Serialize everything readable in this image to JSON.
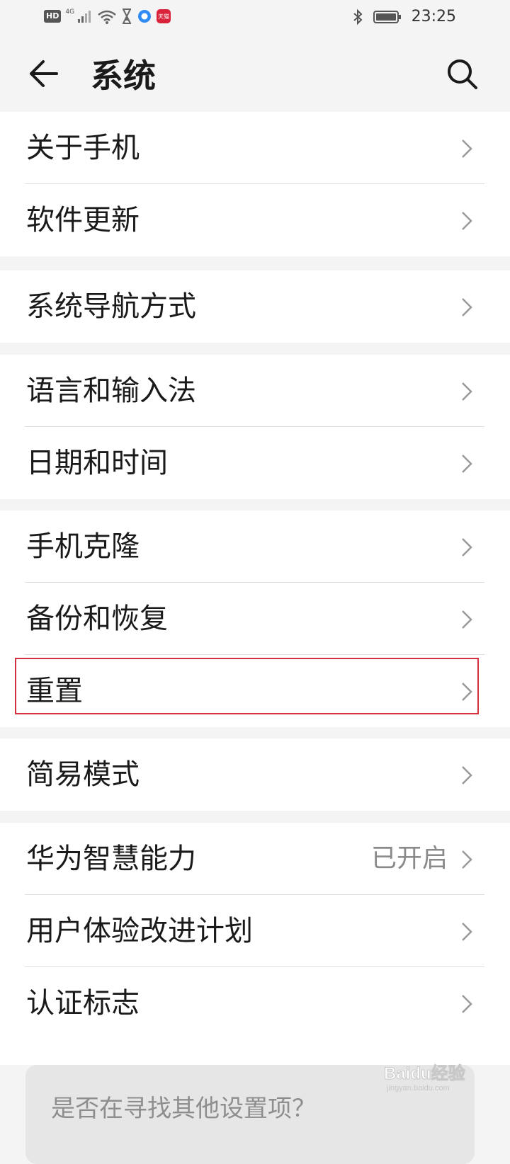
{
  "status_bar": {
    "hd": "HD",
    "network": "4G",
    "app_badge": "天猫",
    "time": "23:25"
  },
  "app_bar": {
    "title": "系统",
    "back_icon": "arrow-left-icon",
    "search_icon": "search-icon"
  },
  "groups": [
    {
      "items": [
        {
          "label": "关于手机"
        },
        {
          "label": "软件更新"
        }
      ]
    },
    {
      "items": [
        {
          "label": "系统导航方式"
        }
      ]
    },
    {
      "items": [
        {
          "label": "语言和输入法"
        },
        {
          "label": "日期和时间"
        }
      ]
    },
    {
      "items": [
        {
          "label": "手机克隆"
        },
        {
          "label": "备份和恢复"
        },
        {
          "label": "重置"
        }
      ]
    },
    {
      "items": [
        {
          "label": "简易模式"
        }
      ]
    },
    {
      "items": [
        {
          "label": "华为智慧能力",
          "value": "已开启"
        },
        {
          "label": "用户体验改进计划"
        },
        {
          "label": "认证标志"
        }
      ]
    }
  ],
  "search_prompt": {
    "text": "是否在寻找其他设置项？"
  },
  "watermark": {
    "text": "Baidu经验",
    "sub": "jingyan.baidu.com"
  },
  "colors": {
    "highlight": "#d63040",
    "background": "#f4f4f4",
    "card": "#ffffff"
  }
}
